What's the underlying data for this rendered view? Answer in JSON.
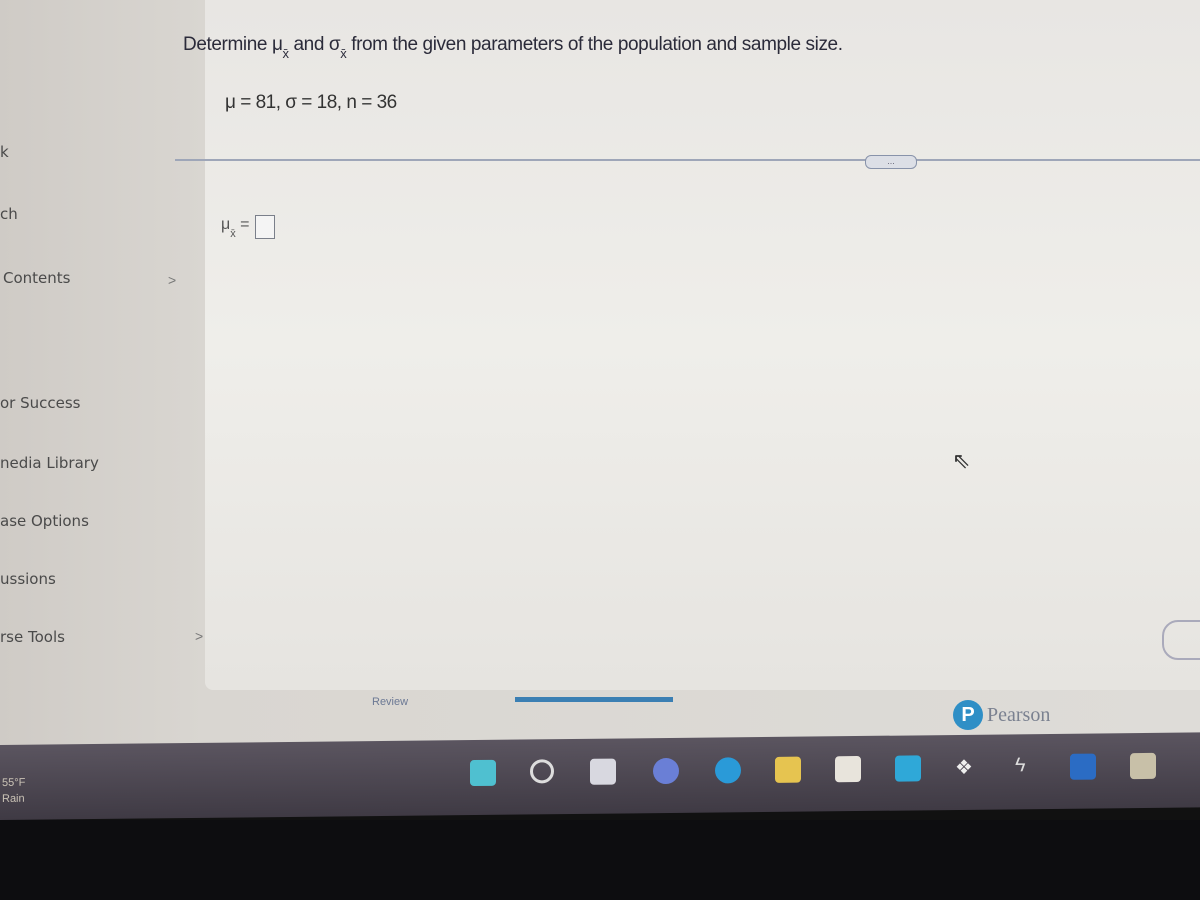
{
  "sidebar": {
    "items": [
      {
        "label": "k"
      },
      {
        "label": "ch"
      },
      {
        "label": "Contents"
      },
      {
        "label": "or Success"
      },
      {
        "label": "nedia Library"
      },
      {
        "label": "ase Options"
      },
      {
        "label": "ussions"
      },
      {
        "label": "rse Tools"
      }
    ]
  },
  "question": {
    "prefix": "Determine ",
    "mu": "μ",
    "sub": "x̄",
    "and": " and ",
    "sigma": "σ",
    "suffix": " from the given parameters of the population and sample size.",
    "params": "μ = 81, σ = 18, n = 36",
    "more": "...",
    "answer_label": "μ",
    "answer_eq": " =",
    "answer_value": ""
  },
  "footer": {
    "review": "Review",
    "brand": "Pearson",
    "brand_initial": "P"
  },
  "taskbar": {
    "temperature": "55°F",
    "condition": "Rain",
    "icons": [
      "windows-start-icon",
      "search-icon",
      "task-view-icon",
      "chat-icon",
      "edge-icon",
      "file-explorer-icon",
      "store-icon",
      "mail-icon",
      "dropbox-icon",
      "app-icon",
      "word-icon",
      "app-icon-2"
    ]
  }
}
